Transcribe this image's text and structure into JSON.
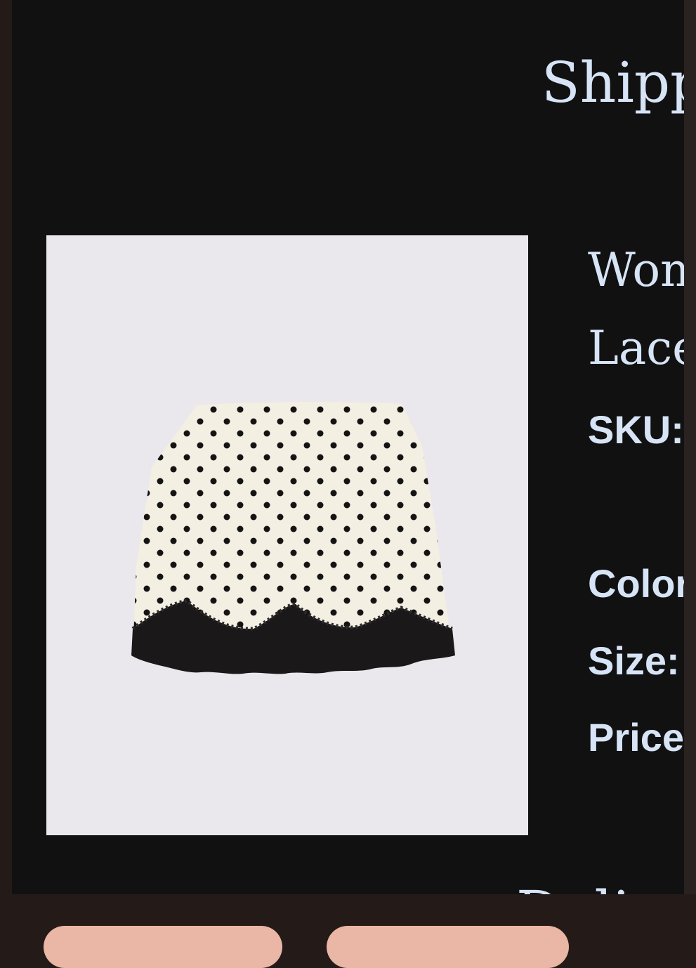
{
  "section_heading": "Shipp",
  "section_heading_bottom": "Deli",
  "product": {
    "title_line1": "Wom",
    "title_line2": "Lace",
    "sku_label": "SKU:",
    "color_label": "Color",
    "size_label": "Size:",
    "price_label": "Price"
  },
  "colors": {
    "background": "#121112",
    "text": "#d6e4f6",
    "pill": "#eab6a6"
  }
}
